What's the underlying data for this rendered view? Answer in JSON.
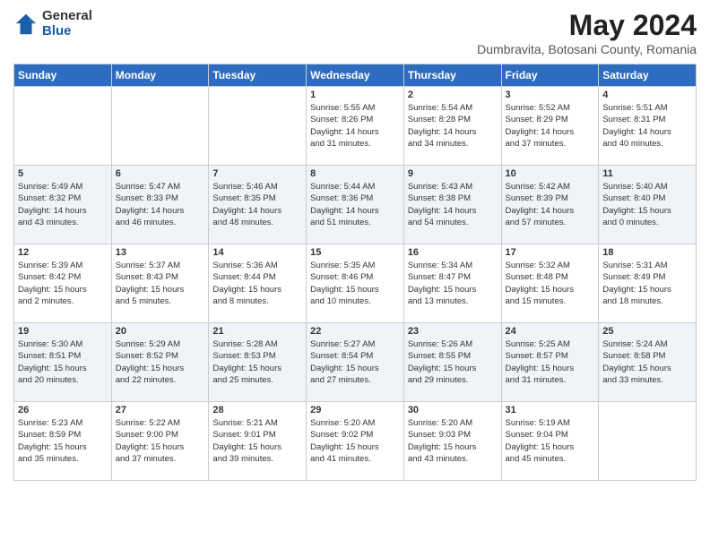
{
  "logo": {
    "general": "General",
    "blue": "Blue"
  },
  "title": {
    "month": "May 2024",
    "location": "Dumbravita, Botosani County, Romania"
  },
  "weekdays": [
    "Sunday",
    "Monday",
    "Tuesday",
    "Wednesday",
    "Thursday",
    "Friday",
    "Saturday"
  ],
  "weeks": [
    [
      {
        "day": "",
        "info": ""
      },
      {
        "day": "",
        "info": ""
      },
      {
        "day": "",
        "info": ""
      },
      {
        "day": "1",
        "info": "Sunrise: 5:55 AM\nSunset: 8:26 PM\nDaylight: 14 hours\nand 31 minutes."
      },
      {
        "day": "2",
        "info": "Sunrise: 5:54 AM\nSunset: 8:28 PM\nDaylight: 14 hours\nand 34 minutes."
      },
      {
        "day": "3",
        "info": "Sunrise: 5:52 AM\nSunset: 8:29 PM\nDaylight: 14 hours\nand 37 minutes."
      },
      {
        "day": "4",
        "info": "Sunrise: 5:51 AM\nSunset: 8:31 PM\nDaylight: 14 hours\nand 40 minutes."
      }
    ],
    [
      {
        "day": "5",
        "info": "Sunrise: 5:49 AM\nSunset: 8:32 PM\nDaylight: 14 hours\nand 43 minutes."
      },
      {
        "day": "6",
        "info": "Sunrise: 5:47 AM\nSunset: 8:33 PM\nDaylight: 14 hours\nand 46 minutes."
      },
      {
        "day": "7",
        "info": "Sunrise: 5:46 AM\nSunset: 8:35 PM\nDaylight: 14 hours\nand 48 minutes."
      },
      {
        "day": "8",
        "info": "Sunrise: 5:44 AM\nSunset: 8:36 PM\nDaylight: 14 hours\nand 51 minutes."
      },
      {
        "day": "9",
        "info": "Sunrise: 5:43 AM\nSunset: 8:38 PM\nDaylight: 14 hours\nand 54 minutes."
      },
      {
        "day": "10",
        "info": "Sunrise: 5:42 AM\nSunset: 8:39 PM\nDaylight: 14 hours\nand 57 minutes."
      },
      {
        "day": "11",
        "info": "Sunrise: 5:40 AM\nSunset: 8:40 PM\nDaylight: 15 hours\nand 0 minutes."
      }
    ],
    [
      {
        "day": "12",
        "info": "Sunrise: 5:39 AM\nSunset: 8:42 PM\nDaylight: 15 hours\nand 2 minutes."
      },
      {
        "day": "13",
        "info": "Sunrise: 5:37 AM\nSunset: 8:43 PM\nDaylight: 15 hours\nand 5 minutes."
      },
      {
        "day": "14",
        "info": "Sunrise: 5:36 AM\nSunset: 8:44 PM\nDaylight: 15 hours\nand 8 minutes."
      },
      {
        "day": "15",
        "info": "Sunrise: 5:35 AM\nSunset: 8:46 PM\nDaylight: 15 hours\nand 10 minutes."
      },
      {
        "day": "16",
        "info": "Sunrise: 5:34 AM\nSunset: 8:47 PM\nDaylight: 15 hours\nand 13 minutes."
      },
      {
        "day": "17",
        "info": "Sunrise: 5:32 AM\nSunset: 8:48 PM\nDaylight: 15 hours\nand 15 minutes."
      },
      {
        "day": "18",
        "info": "Sunrise: 5:31 AM\nSunset: 8:49 PM\nDaylight: 15 hours\nand 18 minutes."
      }
    ],
    [
      {
        "day": "19",
        "info": "Sunrise: 5:30 AM\nSunset: 8:51 PM\nDaylight: 15 hours\nand 20 minutes."
      },
      {
        "day": "20",
        "info": "Sunrise: 5:29 AM\nSunset: 8:52 PM\nDaylight: 15 hours\nand 22 minutes."
      },
      {
        "day": "21",
        "info": "Sunrise: 5:28 AM\nSunset: 8:53 PM\nDaylight: 15 hours\nand 25 minutes."
      },
      {
        "day": "22",
        "info": "Sunrise: 5:27 AM\nSunset: 8:54 PM\nDaylight: 15 hours\nand 27 minutes."
      },
      {
        "day": "23",
        "info": "Sunrise: 5:26 AM\nSunset: 8:55 PM\nDaylight: 15 hours\nand 29 minutes."
      },
      {
        "day": "24",
        "info": "Sunrise: 5:25 AM\nSunset: 8:57 PM\nDaylight: 15 hours\nand 31 minutes."
      },
      {
        "day": "25",
        "info": "Sunrise: 5:24 AM\nSunset: 8:58 PM\nDaylight: 15 hours\nand 33 minutes."
      }
    ],
    [
      {
        "day": "26",
        "info": "Sunrise: 5:23 AM\nSunset: 8:59 PM\nDaylight: 15 hours\nand 35 minutes."
      },
      {
        "day": "27",
        "info": "Sunrise: 5:22 AM\nSunset: 9:00 PM\nDaylight: 15 hours\nand 37 minutes."
      },
      {
        "day": "28",
        "info": "Sunrise: 5:21 AM\nSunset: 9:01 PM\nDaylight: 15 hours\nand 39 minutes."
      },
      {
        "day": "29",
        "info": "Sunrise: 5:20 AM\nSunset: 9:02 PM\nDaylight: 15 hours\nand 41 minutes."
      },
      {
        "day": "30",
        "info": "Sunrise: 5:20 AM\nSunset: 9:03 PM\nDaylight: 15 hours\nand 43 minutes."
      },
      {
        "day": "31",
        "info": "Sunrise: 5:19 AM\nSunset: 9:04 PM\nDaylight: 15 hours\nand 45 minutes."
      },
      {
        "day": "",
        "info": ""
      }
    ]
  ]
}
